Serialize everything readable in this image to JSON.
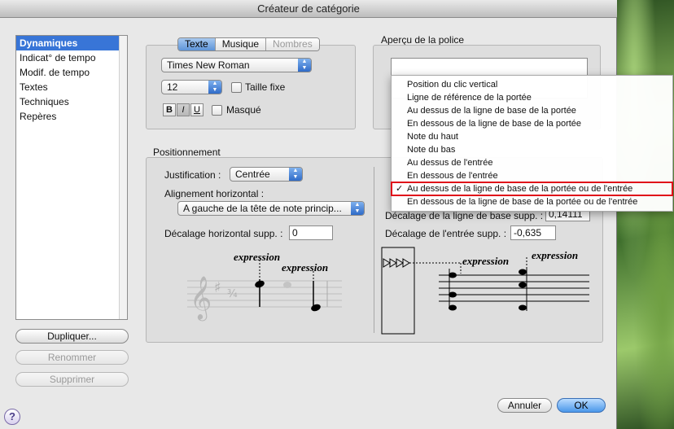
{
  "window": {
    "title": "Créateur de catégorie"
  },
  "sidebar": {
    "items": [
      "Dynamiques",
      "Indicat° de tempo",
      "Modif. de tempo",
      "Textes",
      "Techniques",
      "Repères"
    ],
    "selected_index": 0,
    "buttons": {
      "duplicate": "Dupliquer...",
      "rename": "Renommer",
      "delete": "Supprimer"
    }
  },
  "font_panel": {
    "tabs": [
      "Texte",
      "Musique",
      "Nombres"
    ],
    "active_tab": "Texte",
    "font_name": "Times New Roman",
    "font_size": "12",
    "fixed_size_label": "Taille fixe",
    "style_bold": "B",
    "style_italic": "I",
    "style_underline": "U",
    "hidden_label": "Masqué"
  },
  "preview": {
    "title": "Aperçu de la police"
  },
  "positioning": {
    "title": "Positionnement",
    "justification_label": "Justification :",
    "justification_value": "Centrée",
    "align_h_label": "Alignement horizontal :",
    "align_h_value": "A gauche de la tête de note princip...",
    "offset_h_label": "Décalage horizontal supp. :",
    "offset_h_value": "0",
    "baseline_offset_label": "Décalage de la ligne de base supp. :",
    "baseline_offset_value": "0,14111",
    "entry_offset_label": "Décalage de l'entrée supp. :",
    "entry_offset_value": "-0,635",
    "sample_text": "expression"
  },
  "vertical_menu": {
    "items": [
      "Position du clic vertical",
      "Ligne de référence de la portée",
      "Au dessus de la ligne de base de la portée",
      "En dessous de la ligne de base de la portée",
      "Note du haut",
      "Note du bas",
      "Au dessus de l'entrée",
      "En dessous de l'entrée",
      "Au dessus de la ligne de base de la portée ou de l'entrée",
      "En dessous de la ligne de base de la portée ou de l'entrée"
    ],
    "checked_index": 8,
    "check_mark": "✓"
  },
  "footer": {
    "cancel": "Annuler",
    "ok": "OK",
    "help": "?"
  },
  "colors": {
    "selection": "#3875d7",
    "highlight_box": "#e0101a",
    "default_button": "#4a97ea"
  }
}
